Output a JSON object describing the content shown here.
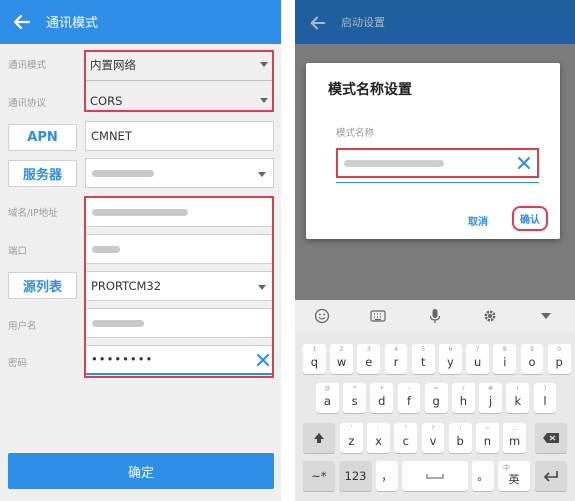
{
  "left": {
    "appbar": {
      "title": "通讯模式"
    },
    "comm_mode": {
      "label": "通讯模式",
      "value": "内置网络"
    },
    "comm_protocol": {
      "label": "通讯协议",
      "value": "CORS"
    },
    "apn": {
      "button": "APN",
      "value": "CMNET"
    },
    "server": {
      "button": "服务器"
    },
    "domain_ip": {
      "label": "域名/IP地址"
    },
    "port": {
      "label": "端口"
    },
    "source_table": {
      "button": "源列表",
      "value": "PRORTCM32"
    },
    "username": {
      "label": "用户名"
    },
    "password": {
      "label": "密码",
      "value": "••••••••"
    },
    "confirm": "确定"
  },
  "right": {
    "appbar": {
      "title": "启动设置"
    },
    "dialog": {
      "title": "模式名称设置",
      "field_label": "模式名称",
      "cancel": "取消",
      "ok": "确认"
    },
    "keyboard": {
      "row1": [
        {
          "k": "q",
          "h": "1"
        },
        {
          "k": "w",
          "h": "2"
        },
        {
          "k": "e",
          "h": "3"
        },
        {
          "k": "r",
          "h": "4"
        },
        {
          "k": "t",
          "h": "5"
        },
        {
          "k": "y",
          "h": "6"
        },
        {
          "k": "u",
          "h": "7"
        },
        {
          "k": "i",
          "h": "8"
        },
        {
          "k": "o",
          "h": "9"
        },
        {
          "k": "p",
          "h": "0"
        }
      ],
      "row2": [
        {
          "k": "a",
          "h": "@"
        },
        {
          "k": "s",
          "h": "*"
        },
        {
          "k": "d",
          "h": "+"
        },
        {
          "k": "f",
          "h": "-"
        },
        {
          "k": "g",
          "h": "="
        },
        {
          "k": "h",
          "h": "/"
        },
        {
          "k": "j",
          "h": "#"
        },
        {
          "k": "k",
          "h": "("
        },
        {
          "k": "l",
          "h": ")"
        }
      ],
      "row3": [
        {
          "k": "z",
          "h": "'"
        },
        {
          "k": "x",
          "h": ":"
        },
        {
          "k": "c",
          "h": "\""
        },
        {
          "k": "v",
          "h": "?"
        },
        {
          "k": "b",
          "h": "!"
        },
        {
          "k": "n",
          "h": "~"
        },
        {
          "k": "m",
          "h": "…"
        }
      ],
      "symbols": "~*",
      "num": "123",
      "comma": "，",
      "period": "。",
      "lang_top": "中",
      "lang": "英"
    }
  }
}
